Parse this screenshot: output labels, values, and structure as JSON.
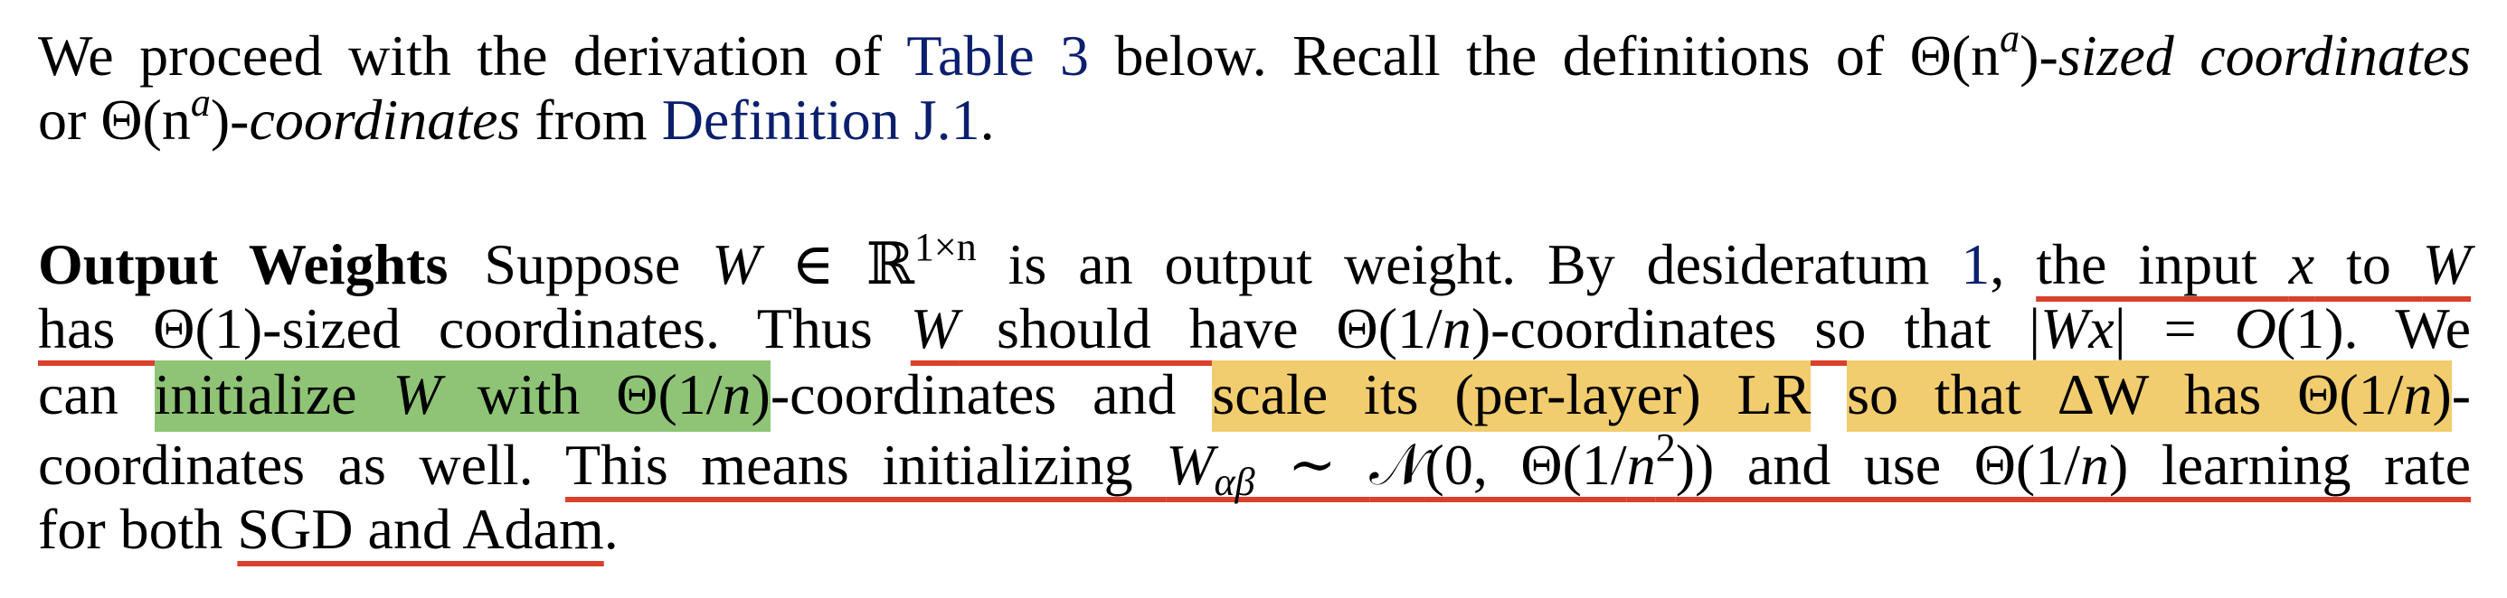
{
  "paragraph1": {
    "line1": {
      "t1": "We proceed with the derivation of ",
      "link_table": "Table 3",
      "t2": " below. Recall the definitions of ",
      "math1": "Θ(n",
      "math1_sup": "a",
      "math1_end": ")",
      "t3": "-sized coordinates"
    },
    "line2": {
      "t1": "or ",
      "math1": "Θ(n",
      "math1_sup": "a",
      "math1_end": ")",
      "t2": "-coordinates",
      "t3": " from ",
      "link_def": "Definition J.1",
      "t4": "."
    }
  },
  "paragraph2": {
    "heading": "Output Weights",
    "line1": {
      "t1": "Suppose ",
      "m_W": "W",
      "t_in": " ∈ ℝ",
      "sup": "1×n",
      "t2": " is an output weight. By desideratum ",
      "link_desid": "1",
      "t3": ", ",
      "ul1": "the input ",
      "m_x": "x",
      "ul1b": " to ",
      "m_W2": "W"
    },
    "line2": {
      "ul1": "has Θ(1)-sized coordinates",
      "t1": ". Thus ",
      "m_W": "W",
      "ul2": " should have Θ(1/",
      "m_n": "n",
      "ul2b": ")-coordinates so that |",
      "m_Wx": "Wx",
      "ul2c": "| = ",
      "m_O": "O",
      "ul2d": "(1).",
      "t2": " We"
    },
    "line3": {
      "t1": "can ",
      "hl_green_a": "initialize ",
      "m_W": "W",
      "hl_green_b": " with Θ(1/",
      "m_n": "n",
      "hl_green_c": ")",
      "t2": "-coordinates and ",
      "hl_yellow1": "scale its (per-layer) LR",
      "hl_yellow2_a": "so that ΔW",
      "hl_yellow2_b": " has Θ(1/",
      "m_n2": "n",
      "hl_yellow2_c": ")",
      "t3": "-"
    },
    "line4": {
      "t1": "coordinates as well. ",
      "ul_a": "This means initializing ",
      "m_W": "W",
      "sub": "αβ",
      "ul_b": " ∼ ",
      "m_N": "𝒩",
      "ul_c": "(0, Θ(1/",
      "m_n": "n",
      "sup": "2",
      "ul_d": ")) and use Θ(1/",
      "m_n2": "n",
      "ul_e": ") learning rate"
    },
    "line5": {
      "t1": "for both ",
      "ul": "SGD and Adam",
      "t2": "."
    }
  },
  "colors": {
    "link": "#0b1f6e",
    "underline": "#d9412b",
    "highlight_green": "#8fc476",
    "highlight_yellow": "#f2cd6f"
  }
}
